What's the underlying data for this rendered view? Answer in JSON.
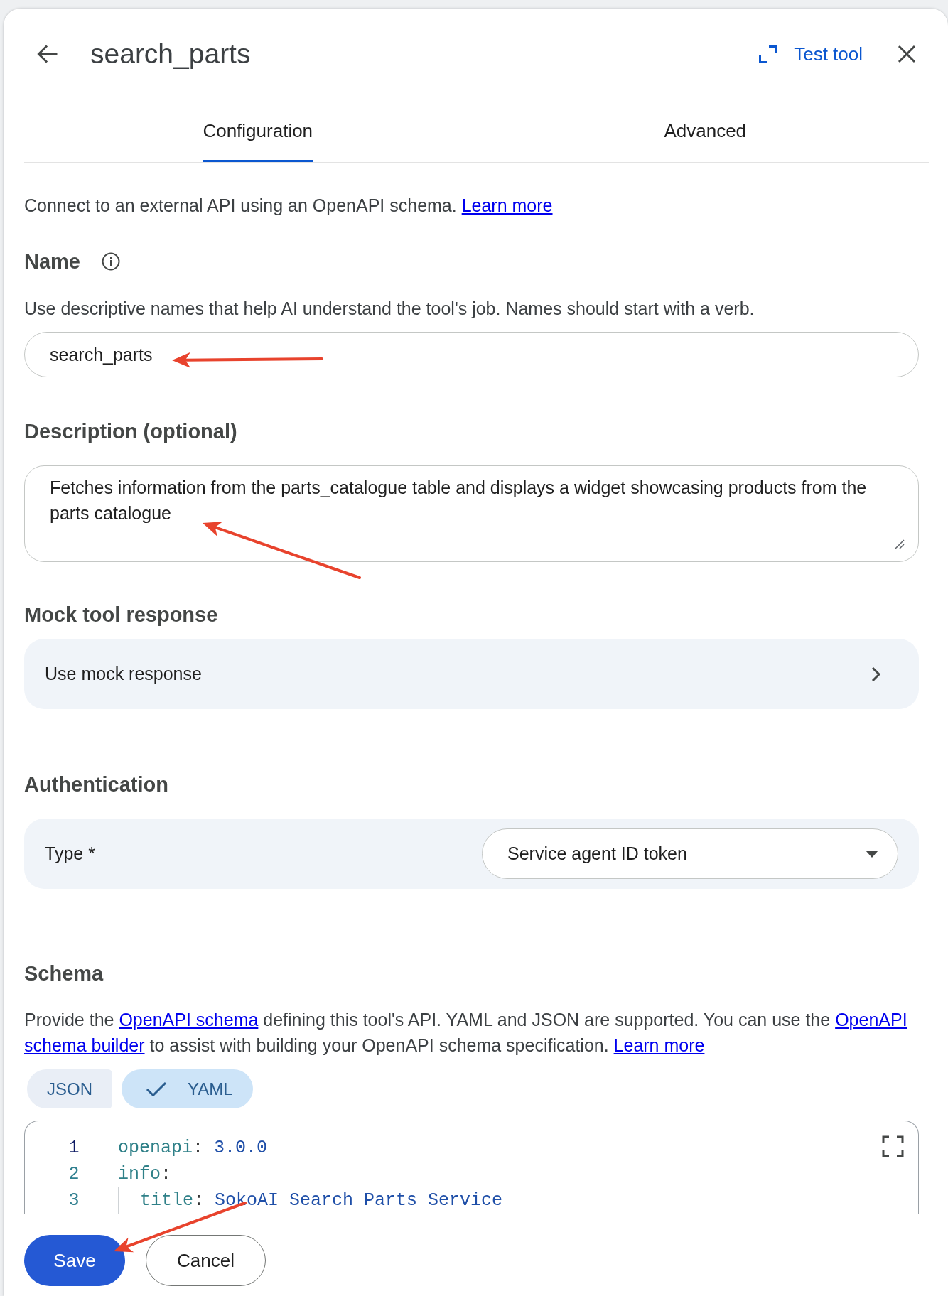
{
  "header": {
    "title": "search_parts",
    "test_tool_button": "Test tool"
  },
  "tabs": [
    {
      "label": "Configuration",
      "selected": true
    },
    {
      "label": "Advanced",
      "selected": false
    }
  ],
  "intro": [
    {
      "kind": "text",
      "text": "Connect to an external API using an OpenAPI schema. "
    },
    {
      "kind": "link",
      "text": "Learn more"
    }
  ],
  "name": {
    "heading": "Name",
    "hint": "Use descriptive names that help AI understand the tool's job. Names should start with a verb.",
    "value": "search_parts",
    "annotation_arrow": true
  },
  "description": {
    "heading": "Description (optional)",
    "value": "Fetches information from the parts_catalogue table and displays a widget showcasing products from the parts catalogue",
    "annotation_arrow": true
  },
  "mock_tool_response": {
    "heading": "Mock tool response",
    "row_label": "Use mock response"
  },
  "authentication": {
    "heading": "Authentication",
    "type_label": "Type *",
    "type_value": "Service agent ID token"
  },
  "schema": {
    "heading": "Schema",
    "description": [
      {
        "kind": "text",
        "text": "Provide the "
      },
      {
        "kind": "link",
        "text": "OpenAPI schema"
      },
      {
        "kind": "text",
        "text": " defining this tool's API. YAML and JSON are supported. You can use the "
      },
      {
        "kind": "link",
        "text": "OpenAPI"
      },
      {
        "kind": "link",
        "text": "schema builder"
      },
      {
        "kind": "text",
        "text": " to assist with building your OpenAPI schema specification. "
      },
      {
        "kind": "link",
        "text": "Learn more"
      }
    ],
    "formats": [
      {
        "label": "JSON",
        "selected": false
      },
      {
        "label": "YAML",
        "selected": true
      }
    ],
    "code": [
      {
        "number": "1",
        "active": true,
        "tokens": [
          {
            "kind": "key",
            "text": "openapi"
          },
          {
            "kind": "punct",
            "text": ":"
          },
          {
            "kind": "value",
            "text": "3.0.0"
          }
        ]
      },
      {
        "number": "2",
        "active": false,
        "tokens": [
          {
            "kind": "key",
            "text": "info"
          },
          {
            "kind": "punct",
            "text": ":"
          }
        ],
        "children": [
          {
            "number": "3",
            "active": false,
            "tokens": [
              {
                "kind": "key",
                "text": "title"
              },
              {
                "kind": "punct",
                "text": ":"
              },
              {
                "kind": "value",
                "text": "SokoAI Search Parts Service"
              }
            ]
          }
        ]
      }
    ]
  },
  "footer": {
    "save": {
      "label": "Save",
      "annotation_arrow": true
    },
    "cancel": "Cancel"
  }
}
